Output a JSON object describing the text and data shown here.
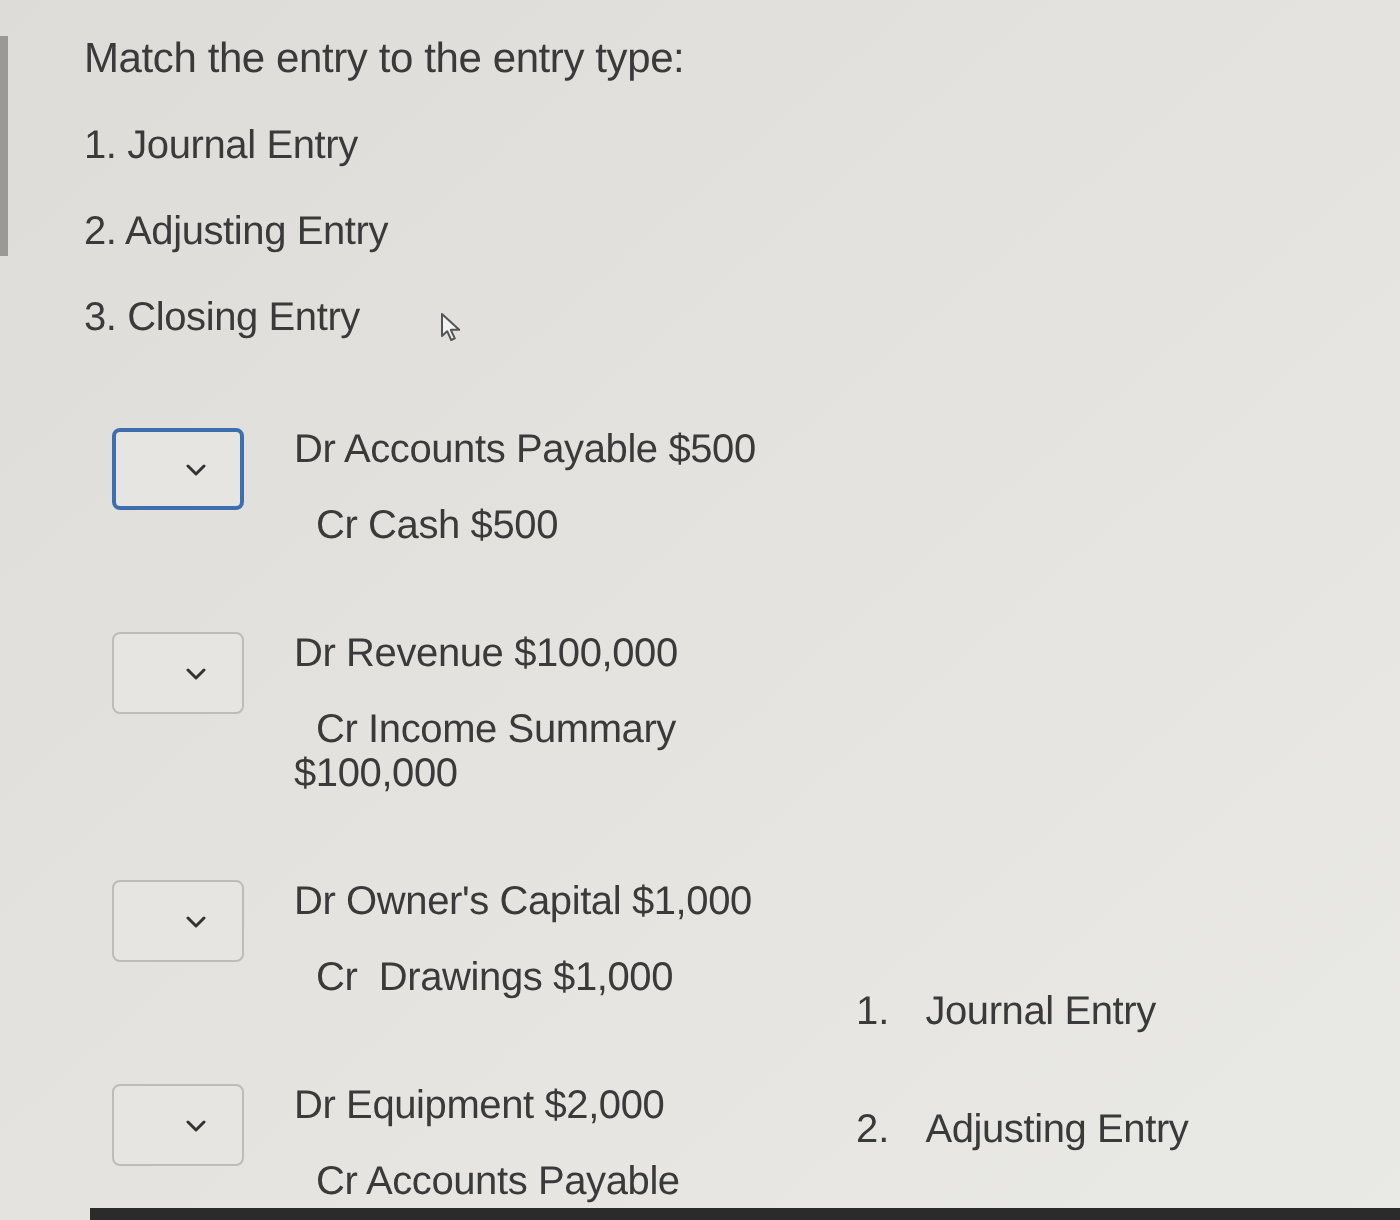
{
  "question": {
    "prompt": "Match the entry to the entry type:",
    "options": [
      "1. Journal Entry",
      "2. Adjusting Entry",
      "3. Closing Entry"
    ]
  },
  "matches": [
    {
      "dropdown": {
        "focused": true
      },
      "debit": "Dr Accounts Payable $500",
      "credit": "Cr Cash $500"
    },
    {
      "dropdown": {
        "focused": false
      },
      "debit": "Dr Revenue $100,000",
      "credit": "Cr Income Summary $100,000"
    },
    {
      "dropdown": {
        "focused": false
      },
      "debit": "Dr Owner's Capital $1,000",
      "credit": "Cr  Drawings $1,000"
    },
    {
      "dropdown": {
        "focused": false
      },
      "debit": "Dr Equipment $2,000",
      "credit": "Cr Accounts Payable"
    }
  ],
  "answer_choices": [
    {
      "number": "1.",
      "label": "Journal Entry"
    },
    {
      "number": "2.",
      "label": "Adjusting Entry"
    }
  ]
}
